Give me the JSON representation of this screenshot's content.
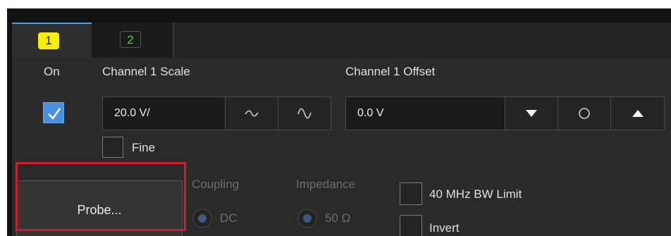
{
  "tabs": [
    {
      "label": "1",
      "color": "#f4f000",
      "selected": true
    },
    {
      "label": "2",
      "color": "#2fe02f",
      "selected": false
    }
  ],
  "on": {
    "label": "On",
    "checked": true
  },
  "scale": {
    "label": "Channel 1 Scale",
    "value": "20.0 V/",
    "buttons": [
      "decrease-wave-icon",
      "increase-wave-icon"
    ]
  },
  "offset": {
    "label": "Channel 1 Offset",
    "value": "0.0 V",
    "buttons": [
      "triangle-down-icon",
      "circle-icon",
      "triangle-up-icon"
    ]
  },
  "fine": {
    "label": "Fine",
    "checked": false
  },
  "probe": {
    "label": "Probe..."
  },
  "coupling": {
    "label": "Coupling",
    "option": "DC",
    "enabled": false
  },
  "impedance": {
    "label": "Impedance",
    "option": "50 Ω",
    "enabled": false
  },
  "bw_limit": {
    "label": "40 MHz BW Limit",
    "checked": false
  },
  "invert": {
    "label": "Invert",
    "checked": false
  },
  "colors": {
    "accent": "#4a90e2",
    "highlight": "#d11a2a",
    "tab_indicator": "#4aa3f0"
  }
}
